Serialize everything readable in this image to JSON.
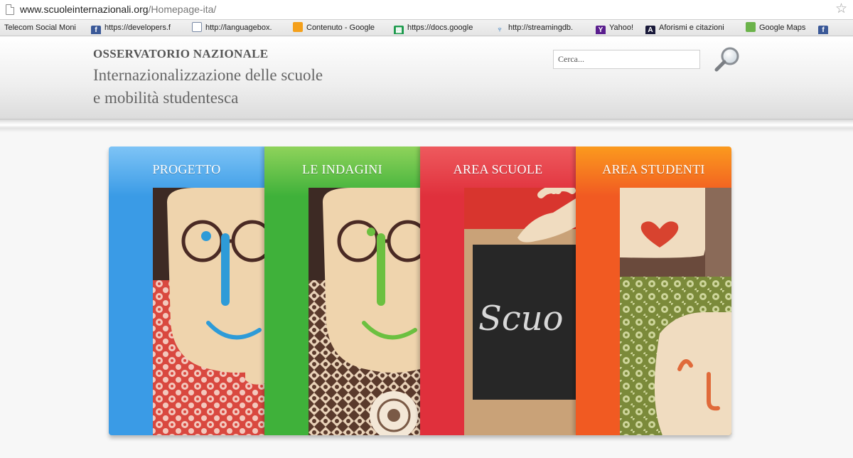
{
  "browser": {
    "url_host": "www.scuoleinternazionali.org",
    "url_path": "/Homepage-ita/",
    "bookmarks": [
      {
        "label": "Telecom Social Moni",
        "icon": "none"
      },
      {
        "label": "https://developers.f",
        "icon": "facebook-icon"
      },
      {
        "label": "http://languagebox.",
        "icon": "document-icon"
      },
      {
        "label": "Contenuto - Google",
        "icon": "google-drive-icon"
      },
      {
        "label": "https://docs.google",
        "icon": "spreadsheet-icon"
      },
      {
        "label": "http://streamingdb.",
        "icon": "stream-icon"
      },
      {
        "label": "Yahoo!",
        "icon": "yahoo-icon"
      },
      {
        "label": "Aforismi e citazioni",
        "icon": "aforismi-icon"
      },
      {
        "label": "Google Maps",
        "icon": "google-maps-icon"
      },
      {
        "label": "",
        "icon": "facebook-icon"
      }
    ]
  },
  "header": {
    "title_top": "OSSERVATORIO NAZIONALE",
    "subtitle_line1": "Internazionalizzazione delle scuole",
    "subtitle_line2": "e mobilità studentesca",
    "search": {
      "placeholder": "Cerca...",
      "button_icon": "magnifier-icon"
    }
  },
  "tiles": [
    {
      "label": "PROGETTO",
      "color": "#3a9be6",
      "top_color": "#7ec4f6"
    },
    {
      "label": "LE INDAGINI",
      "color": "#3fb13a",
      "top_color": "#8fd35b"
    },
    {
      "label": "AREA SCUOLE",
      "color": "#e0303c",
      "top_color": "#ee5a5e"
    },
    {
      "label": "AREA STUDENTI",
      "color": "#f15a22",
      "top_color": "#fb9a1e"
    }
  ],
  "blackboard_text": "Scuo"
}
